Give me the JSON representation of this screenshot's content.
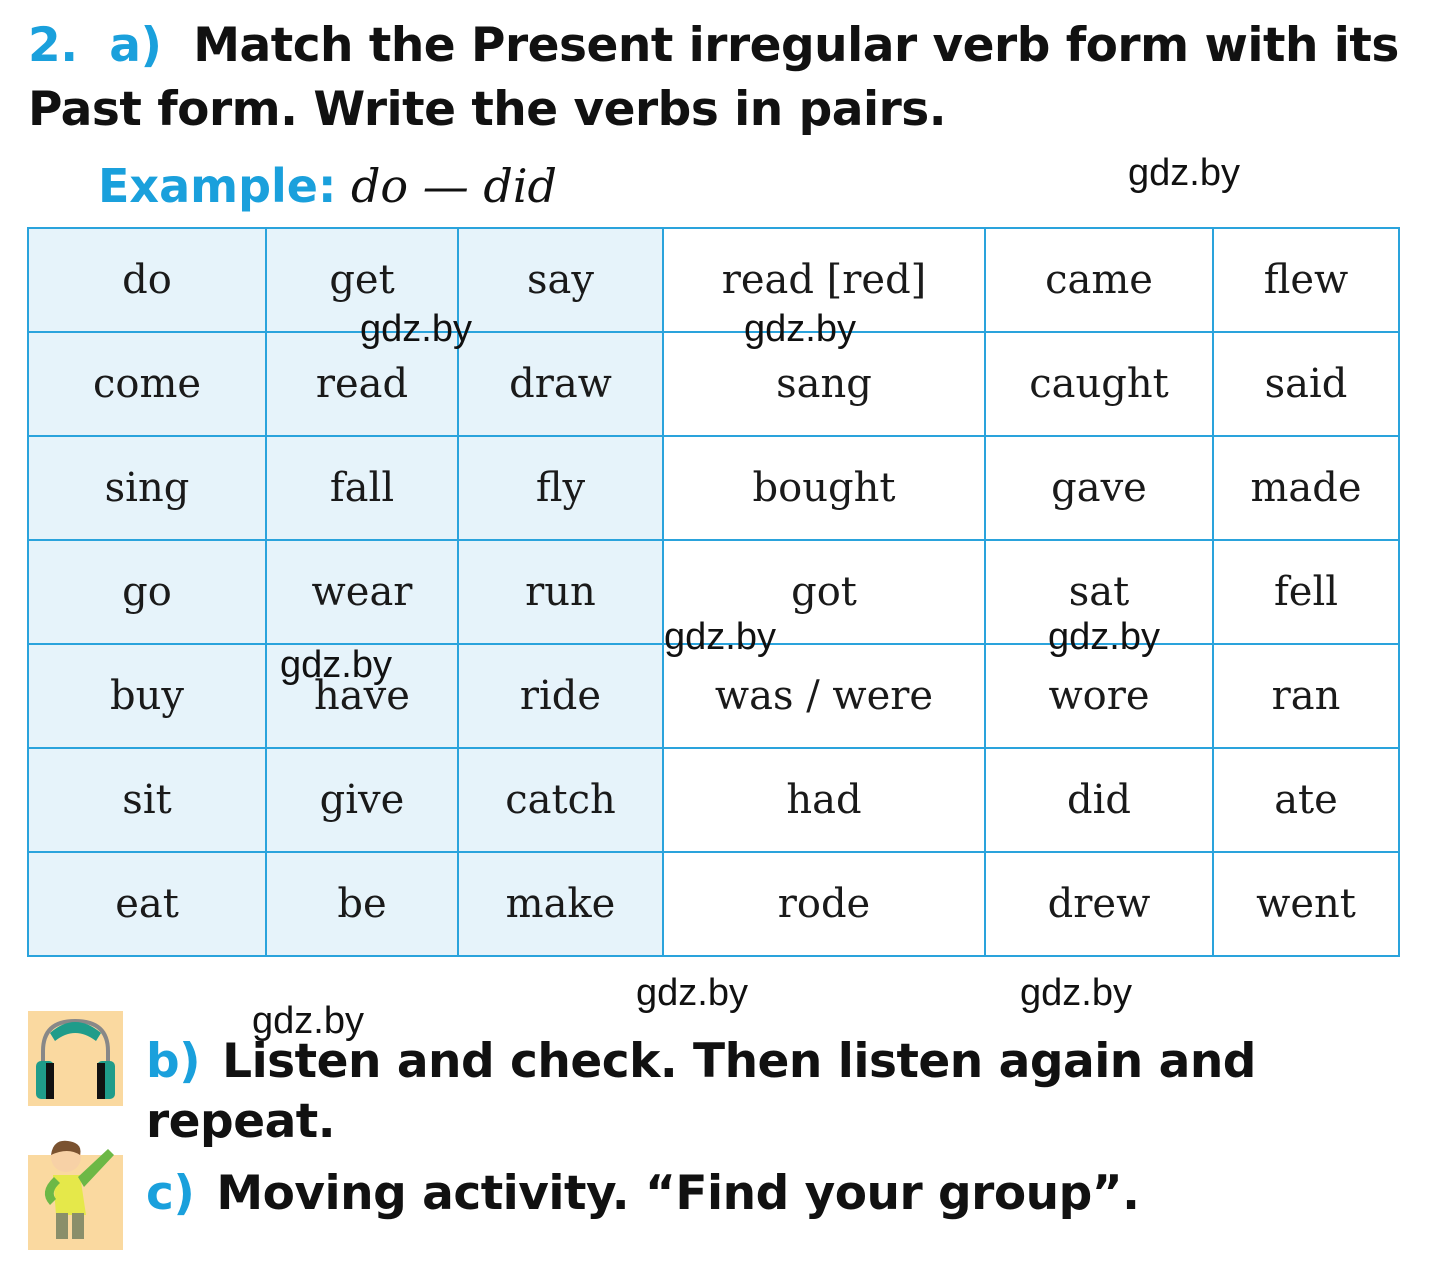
{
  "heading": {
    "number": "2.",
    "part": "a)",
    "text": "Match the Present irregular verb form with its Past form. Write the verbs in pairs."
  },
  "example": {
    "label": "Example:",
    "text": "do — did"
  },
  "table": {
    "rows": [
      [
        "do",
        "get",
        "say",
        "read [red]",
        "came",
        "flew"
      ],
      [
        "come",
        "read",
        "draw",
        "sang",
        "caught",
        "said"
      ],
      [
        "sing",
        "fall",
        "fly",
        "bought",
        "gave",
        "made"
      ],
      [
        "go",
        "wear",
        "run",
        "got",
        "sat",
        "fell"
      ],
      [
        "buy",
        "have",
        "ride",
        "was / were",
        "wore",
        "ran"
      ],
      [
        "sit",
        "give",
        "catch",
        "had",
        "did",
        "ate"
      ],
      [
        "eat",
        "be",
        "make",
        "rode",
        "drew",
        "went"
      ]
    ]
  },
  "task_b": {
    "part": "b)",
    "text": "Listen and check. Then listen again and repeat.",
    "icon": "headphones-icon"
  },
  "task_c": {
    "part": "c)",
    "text": "Moving activity. “Find your group”.",
    "icon": "boy-waving-icon"
  },
  "watermarks": [
    "gdz.by",
    "gdz.by",
    "gdz.by",
    "gdz.by",
    "gdz.by",
    "gdz.by",
    "gdz.by",
    "gdz.by",
    "gdz.by"
  ],
  "colors": {
    "accent": "#1aa0dc",
    "table_border": "#2aa3dc",
    "shaded_cell": "#e6f3fa",
    "icon_bg": "#fad9a0"
  }
}
